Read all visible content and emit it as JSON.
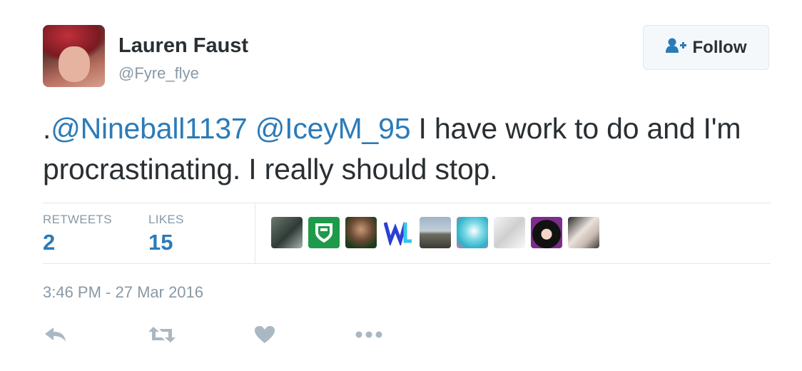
{
  "author": {
    "name": "Lauren Faust",
    "handle": "@Fyre_flye"
  },
  "follow_button": {
    "label": "Follow",
    "icon": "add-user-icon"
  },
  "tweet": {
    "prefix": ".",
    "mention1": "@Nineball1137",
    "mention2": "@IceyM_95",
    "body": " I have work to do and I'm procrastinating.  I really should stop."
  },
  "stats": {
    "retweets_label": "RETWEETS",
    "retweets_count": "2",
    "likes_label": "LIKES",
    "likes_count": "15"
  },
  "timestamp": "3:46 PM - 27 Mar 2016",
  "actions": [
    "reply-icon",
    "retweet-icon",
    "like-icon",
    "more-icon"
  ],
  "colors": {
    "link": "#2b7bb9",
    "text": "#292f33",
    "muted": "#8899a6",
    "border": "#e1e8ed"
  }
}
